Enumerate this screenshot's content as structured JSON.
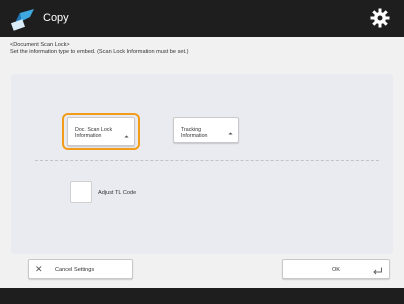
{
  "app": {
    "title": "Copy",
    "icon": "copy-app-icon",
    "settings_icon": "gear-icon"
  },
  "instructions": {
    "line1": "<Document Scan Lock>",
    "line2": "Set the information type to embed. (Scan Lock Information must be set.)"
  },
  "options": {
    "doc_scan_lock": {
      "line1": "Doc. Scan Lock",
      "line2": "Information",
      "selected": true
    },
    "tracking": {
      "line1": "Tracking",
      "line2": "Information"
    }
  },
  "adjust": {
    "label": "Adjust TL Code",
    "checked": false
  },
  "footer": {
    "cancel_label": "Cancel Settings",
    "ok_label": "OK"
  },
  "colors": {
    "header": "#1e1e1e",
    "panel": "#e9ebf1",
    "focus": "#f39c1a"
  }
}
